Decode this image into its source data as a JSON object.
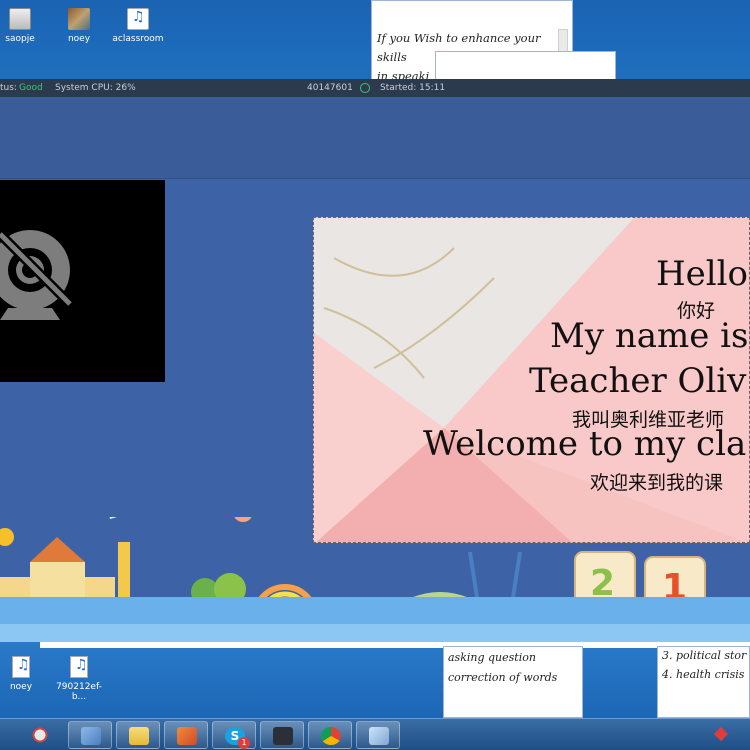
{
  "desktop_top": {
    "icons": [
      {
        "label": "saopje",
        "icon": "drive-icon"
      },
      {
        "label": "noey",
        "icon": "image-file-icon"
      },
      {
        "label": "aclassroom",
        "icon": "mp3-file-icon"
      }
    ],
    "note": {
      "lines": [
        "If you Wish to enhance your",
        "skills",
        "in speaki"
      ]
    }
  },
  "status_bar": {
    "status_prefix": "tus:",
    "status_value": "Good",
    "cpu": "System CPU: 26%",
    "id": "40147601",
    "started": "Started: 15:11"
  },
  "slide": {
    "hello": "Hello",
    "nihao": "你好",
    "my_name": "My name is",
    "teacher": "Teacher Oliv",
    "wojiao": "我叫奥利维亚老师",
    "welcome": "Welcome to my cla",
    "huanying": "欢迎来到我的课"
  },
  "desktop_bottom": {
    "icons": [
      {
        "label": "noey",
        "icon": "mp3-file-icon"
      },
      {
        "label": "790212ef-b...",
        "icon": "mp3-file-icon"
      }
    ],
    "note_left": [
      "asking question",
      "correction of words"
    ],
    "note_right": [
      "3. political stor",
      "4. health crisis"
    ]
  },
  "taskbar": {
    "apps": [
      "chrome-like-icon",
      "paint-icon",
      "folder-icon",
      "gymnast-icon",
      "skype-icon",
      "bird-icon",
      "chrome-icon",
      "notes-icon"
    ],
    "skype_badge": "1"
  },
  "colors": {
    "status_good": "#3cc47a",
    "classroom_bg": "#3d63a6",
    "slide_pink": "#f7c3c1"
  }
}
